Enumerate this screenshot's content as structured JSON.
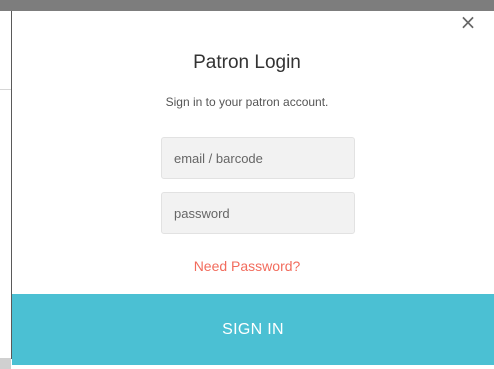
{
  "modal": {
    "title": "Patron Login",
    "subtitle": "Sign in to your patron account.",
    "close_icon": "×",
    "email_placeholder": "email / barcode",
    "email_value": "",
    "password_placeholder": "password",
    "password_value": "",
    "need_password_link": "Need Password?",
    "signin_button": "SIGN IN"
  },
  "colors": {
    "accent": "#4bc0d3",
    "link": "#f26c5d",
    "field_bg": "#f2f2f2"
  }
}
